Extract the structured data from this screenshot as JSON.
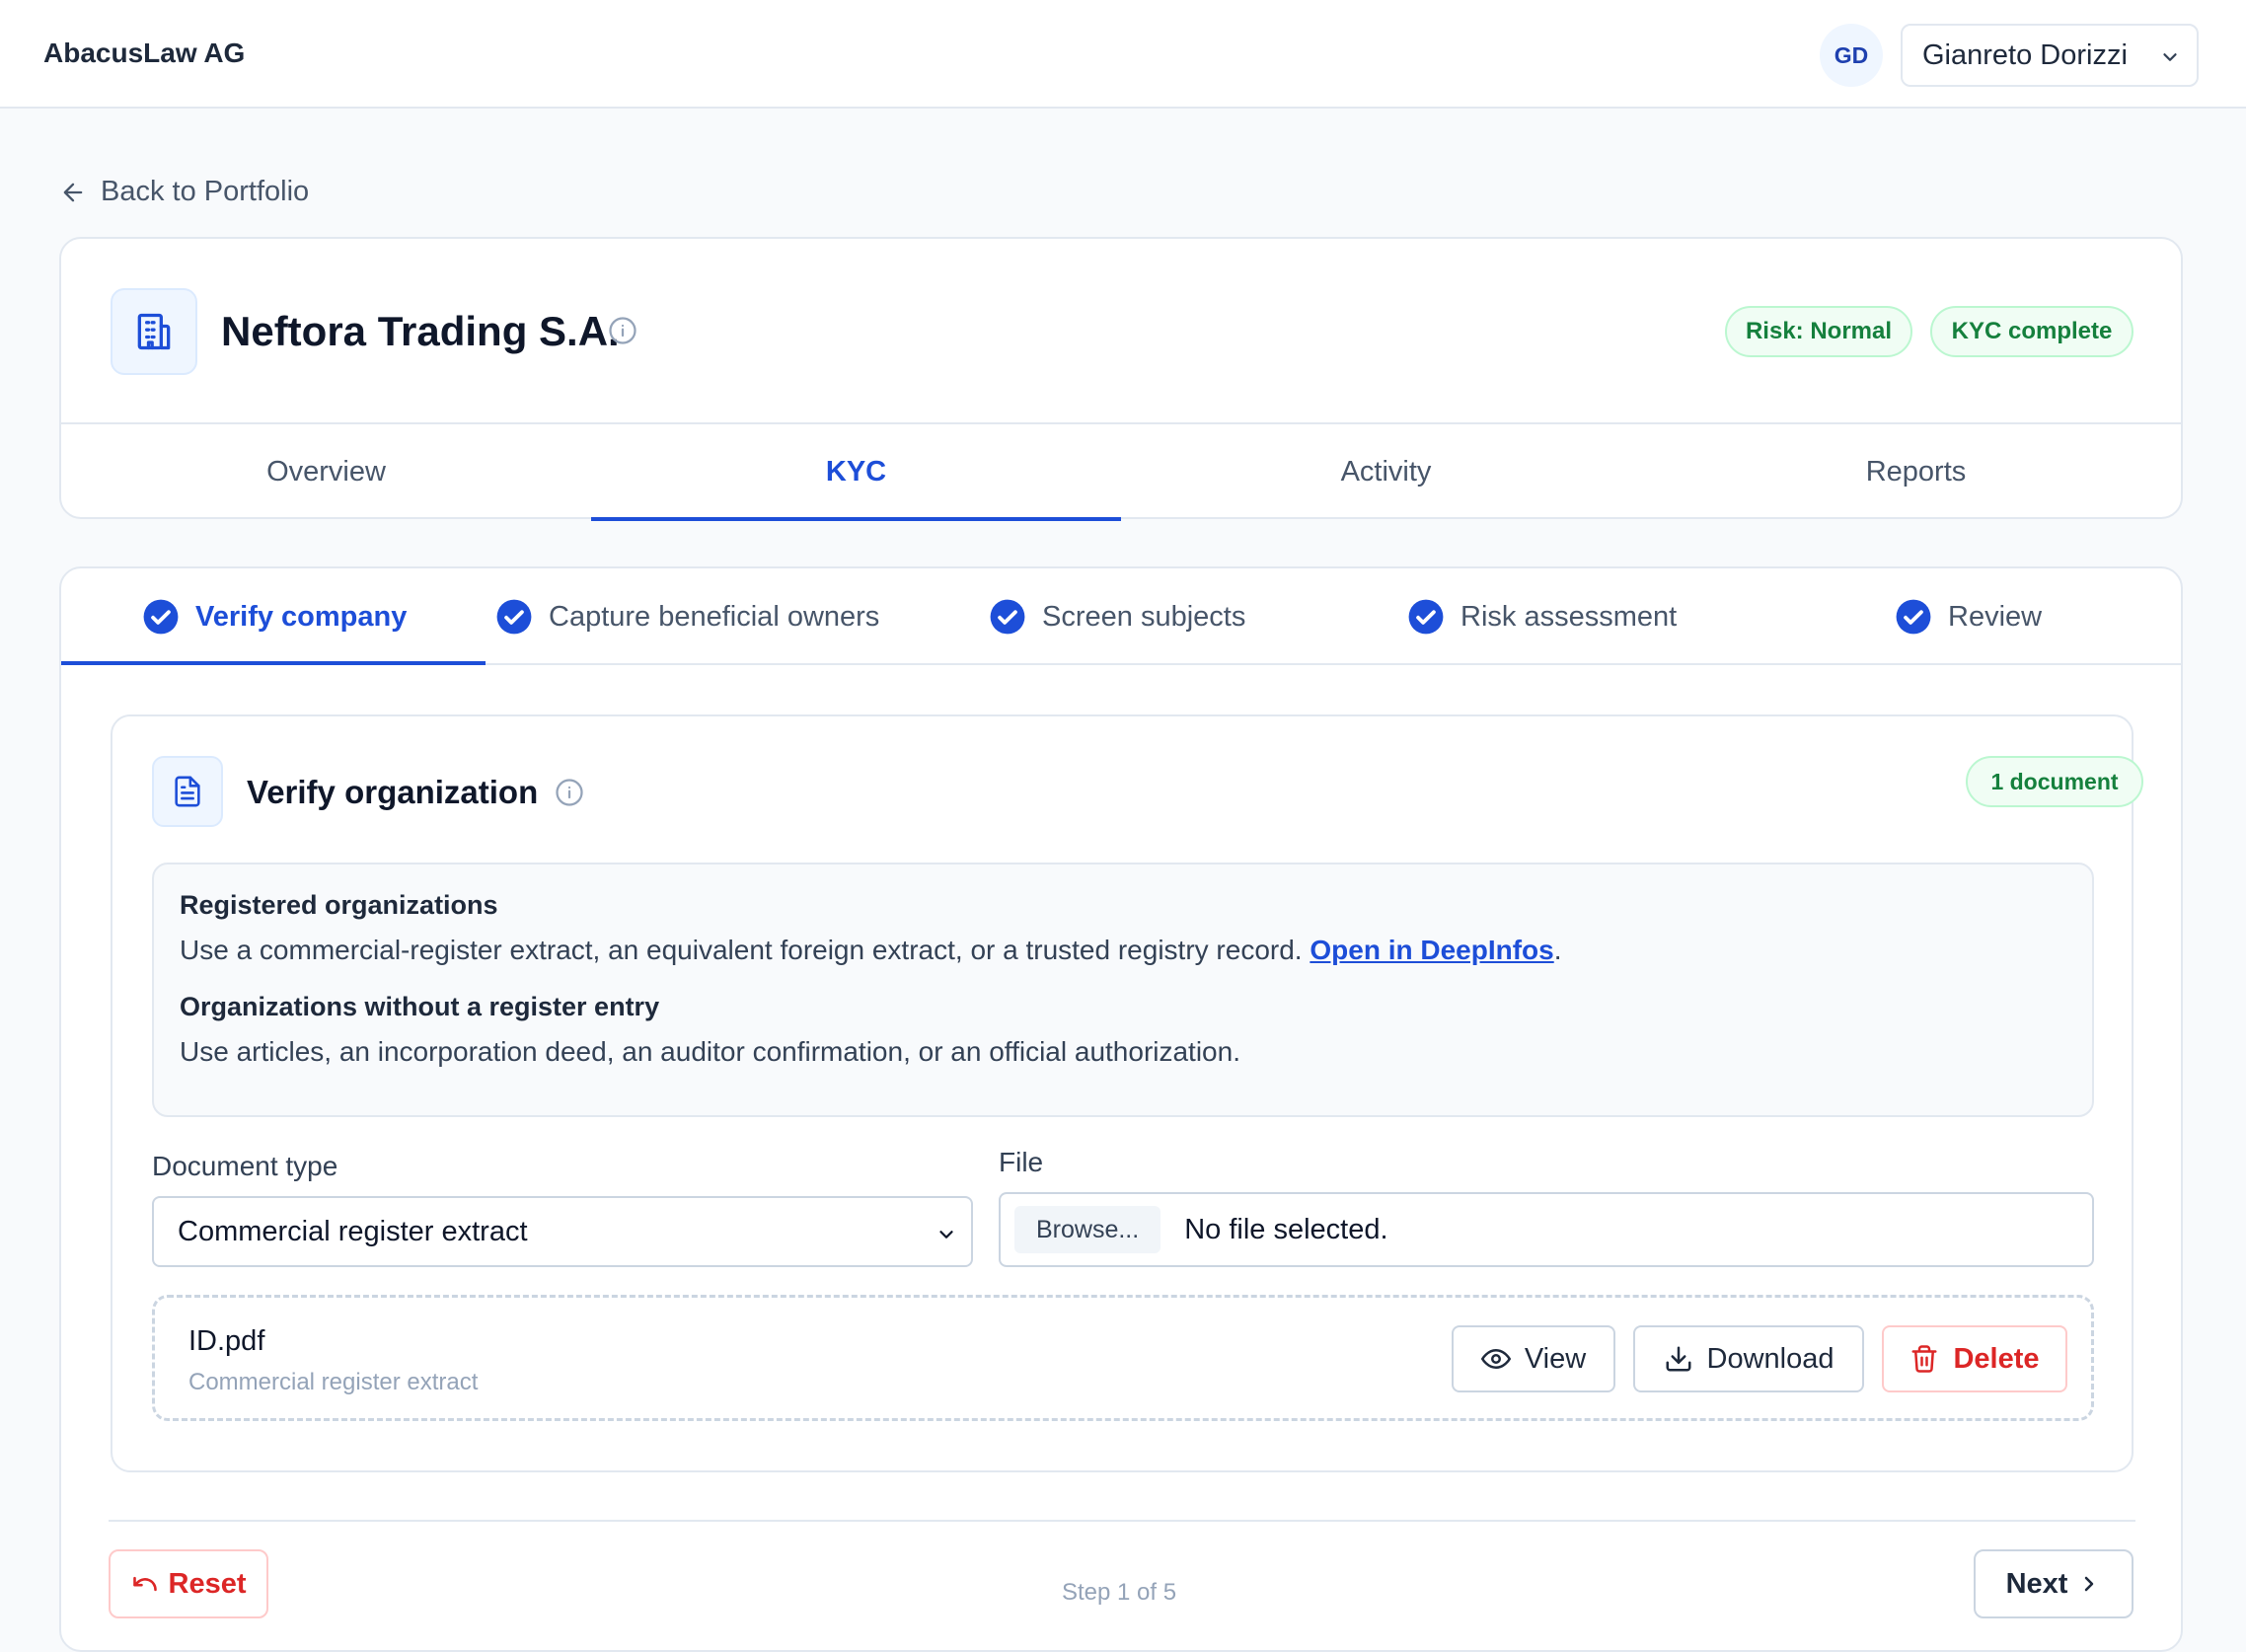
{
  "app": {
    "brand": "AbacusLaw AG"
  },
  "user": {
    "initials": "GD",
    "name": "Gianreto Dorizzi"
  },
  "nav": {
    "back_label": "Back to Portfolio"
  },
  "organization": {
    "name": "Neftora Trading S.A.",
    "badges": {
      "risk": "Risk: Normal",
      "kyc": "KYC complete"
    }
  },
  "tabs": [
    {
      "label": "Overview"
    },
    {
      "label": "KYC"
    },
    {
      "label": "Activity"
    },
    {
      "label": "Reports"
    }
  ],
  "active_tab": "KYC",
  "steps": [
    {
      "label": "Verify company",
      "completed": true
    },
    {
      "label": "Capture beneficial owners",
      "completed": true
    },
    {
      "label": "Screen subjects",
      "completed": true
    },
    {
      "label": "Risk assessment",
      "completed": true
    },
    {
      "label": "Review",
      "completed": true
    }
  ],
  "active_step": "Verify company",
  "verify": {
    "title": "Verify organization",
    "doc_badge": "1 document",
    "info": {
      "registered_heading": "Registered organizations",
      "registered_text": "Use a commercial-register extract, an equivalent foreign extract, or a trusted registry record. ",
      "registered_link": "Open in DeepInfos",
      "registered_suffix": ".",
      "unregistered_heading": "Organizations without a register entry",
      "unregistered_text": "Use articles, an incorporation deed, an auditor confirmation, or an official authorization."
    },
    "document_type_label": "Document type",
    "document_type_value": "Commercial register extract",
    "file_label": "File",
    "browse_label": "Browse...",
    "file_status": "No file selected.",
    "uploaded": {
      "name": "ID.pdf",
      "type": "Commercial register extract",
      "actions": {
        "view": "View",
        "download": "Download",
        "delete": "Delete"
      }
    }
  },
  "footer": {
    "reset": "Reset",
    "step_count": "Step 1 of 5",
    "next": "Next"
  },
  "colors": {
    "accent": "#1d4ed8",
    "success": "#15803d",
    "danger": "#dc2626"
  }
}
